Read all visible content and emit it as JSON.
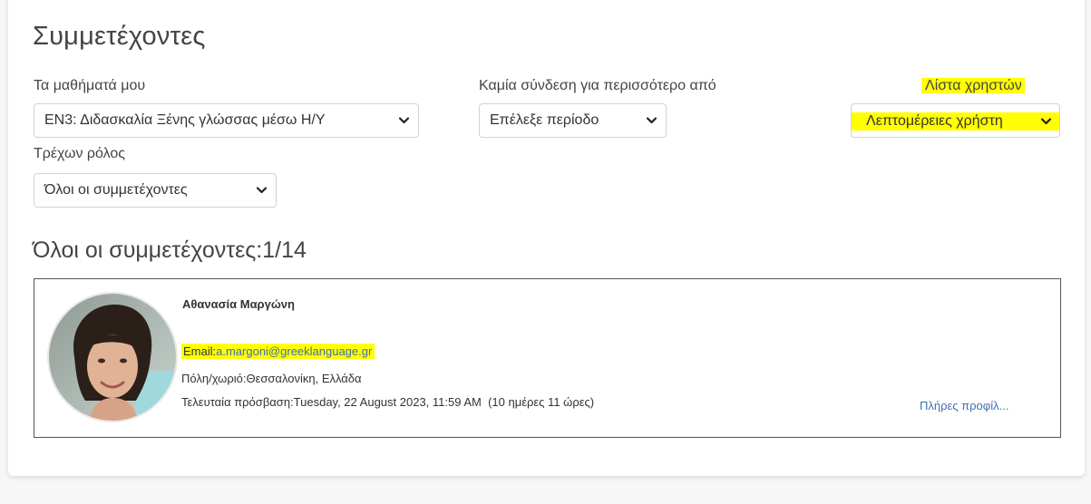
{
  "page": {
    "title": "Συμμετέχοντες"
  },
  "filters": {
    "my_courses_label": "Τα μαθήματά μου",
    "my_courses_value": "ΕΝ3: Διδασκαλία Ξένης γλώσσας μέσω Η/Υ",
    "inactive_label": "Καμία σύνδεση για περισσότερο από",
    "inactive_value": "Επέλεξε περίοδο",
    "user_list_label": "Λίστα χρηστών",
    "user_list_value": "Λεπτομέρειες χρήστη",
    "role_label": "Τρέχων ρόλος",
    "role_value": "Όλοι οι συμμετέχοντες"
  },
  "participants": {
    "heading": "Όλοι οι συμμετέχοντες:1/14",
    "user": {
      "name": "Αθανασία Μαργώνη",
      "email_label": "Email:",
      "email": "a.margoni@greeklanguage.gr",
      "city_label": "Πόλη/χωριό:",
      "city": "Θεσσαλονίκη, Ελλάδα",
      "last_access_label": "Τελευταία πρόσβαση:",
      "last_access": "Tuesday, 22 August 2023, 11:59 AM  (10 ημέρες 11 ώρες)",
      "profile_link": "Πλήρες προφίλ..."
    }
  },
  "colors": {
    "highlight": "#ffff00",
    "link": "#3f6fb5",
    "email_text": "#3f6fb5"
  },
  "icons": {
    "dropdown": "chevron-down-icon",
    "avatar": "user-photo"
  }
}
